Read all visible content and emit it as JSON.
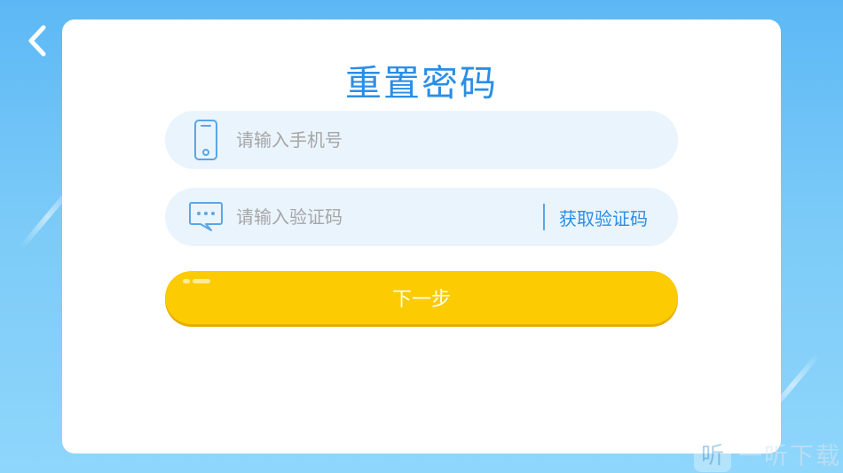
{
  "header": {
    "back_icon": "chevron-left-icon"
  },
  "card": {
    "title": "重置密码"
  },
  "phone_field": {
    "icon": "phone-icon",
    "placeholder": "请输入手机号",
    "value": ""
  },
  "code_field": {
    "icon": "message-icon",
    "placeholder": "请输入验证码",
    "value": "",
    "get_code_label": "获取验证码"
  },
  "next_button": {
    "label": "下一步"
  },
  "watermark": {
    "logo_char": "听",
    "text": "一听下载"
  },
  "colors": {
    "primary": "#2a8ee6",
    "button": "#fccb02",
    "field_bg": "#eaf4fd"
  }
}
